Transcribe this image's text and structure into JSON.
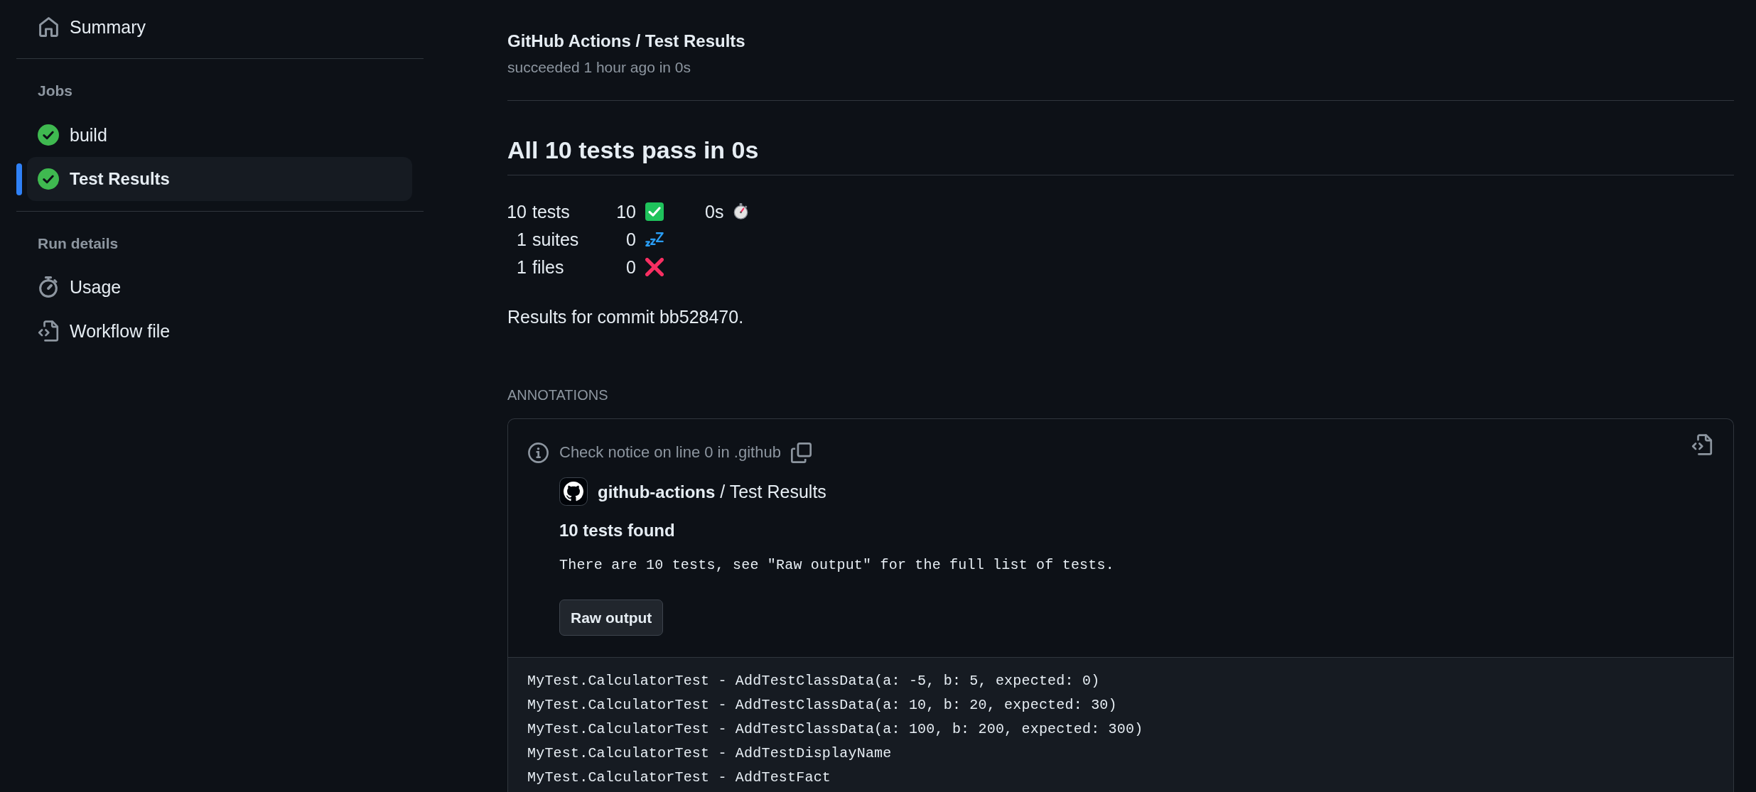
{
  "sidebar": {
    "summary": {
      "label": "Summary",
      "kind": "summary",
      "selected": false
    },
    "sections": [
      {
        "heading": "Jobs",
        "items": [
          {
            "label": "build",
            "kind": "job",
            "passed": true,
            "selected": false
          },
          {
            "label": "Test Results",
            "kind": "job",
            "passed": true,
            "selected": true
          }
        ]
      },
      {
        "heading": "Run details",
        "items": [
          {
            "label": "Usage",
            "kind": "usage",
            "selected": false
          },
          {
            "label": "Workflow file",
            "kind": "workflow",
            "selected": false
          }
        ]
      }
    ]
  },
  "header": {
    "title": "GitHub Actions / Test Results",
    "subtitle": "succeeded 1 hour ago in 0s"
  },
  "summary": {
    "heading": "All 10 tests pass in 0s",
    "stats": [
      {
        "count": "10",
        "unit": "tests",
        "result": "10",
        "kind": "passed",
        "duration": "0s"
      },
      {
        "count": "1",
        "unit": "suites",
        "result": "0",
        "kind": "skipped"
      },
      {
        "count": "1",
        "unit": "files",
        "result": "0",
        "kind": "failed"
      }
    ],
    "commit_note": "Results for commit bb528470."
  },
  "annotations": {
    "heading": "ANNOTATIONS",
    "items": [
      {
        "kind": "notice",
        "location": "Check notice on line 0 in .github",
        "source": "**github-actions** / Test Results",
        "title": "10 tests found",
        "message": "There are 10 tests, see \"Raw output\" for the full list of tests.",
        "button": "Raw output",
        "expanded": true,
        "raw_output": [
          "MyTest.CalculatorTest - AddTestClassData(a: -5, b: 5, expected: 0)",
          "MyTest.CalculatorTest - AddTestClassData(a: 10, b: 20, expected: 30)",
          "MyTest.CalculatorTest - AddTestClassData(a: 100, b: 200, expected: 300)",
          "MyTest.CalculatorTest - AddTestDisplayName",
          "MyTest.CalculatorTest - AddTestFact"
        ]
      }
    ]
  }
}
